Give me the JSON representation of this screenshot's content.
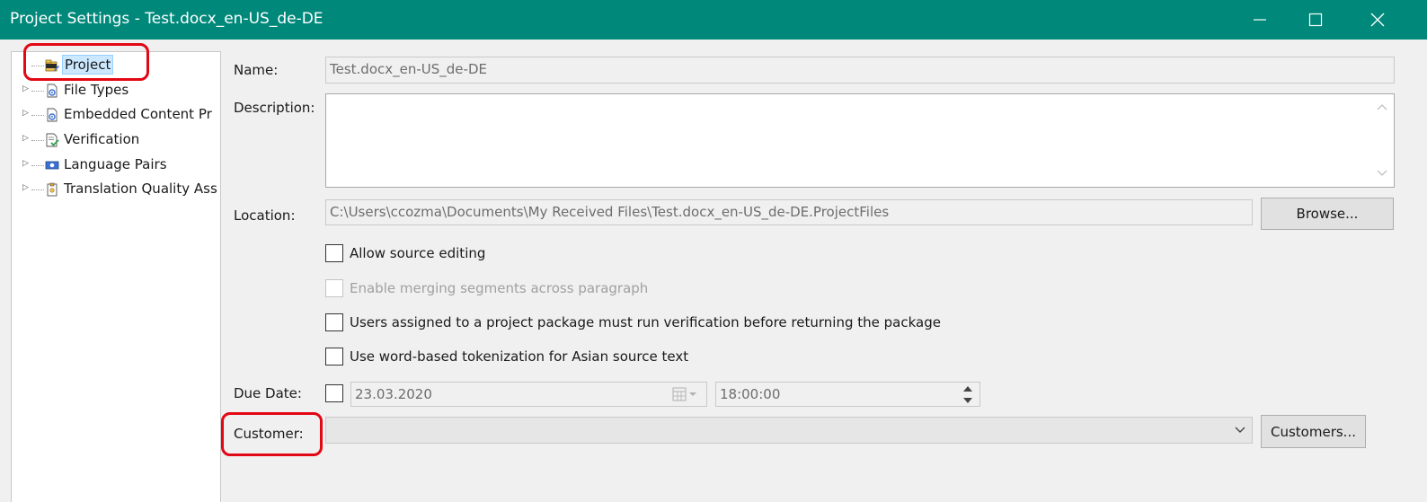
{
  "window": {
    "title": "Project Settings - Test.docx_en-US_de-DE"
  },
  "tree": {
    "items": [
      {
        "label": "Project",
        "icon": "project-icon",
        "selected": true,
        "expandable": false
      },
      {
        "label": "File Types",
        "icon": "file-types-icon",
        "selected": false,
        "expandable": true
      },
      {
        "label": "Embedded Content Pr",
        "icon": "embedded-content-icon",
        "selected": false,
        "expandable": true
      },
      {
        "label": "Verification",
        "icon": "verification-icon",
        "selected": false,
        "expandable": true
      },
      {
        "label": "Language Pairs",
        "icon": "language-pairs-icon",
        "selected": false,
        "expandable": true
      },
      {
        "label": "Translation Quality Ass",
        "icon": "translation-quality-icon",
        "selected": false,
        "expandable": true
      }
    ]
  },
  "form": {
    "name_label": "Name:",
    "name_value": "Test.docx_en-US_de-DE",
    "description_label": "Description:",
    "description_value": "",
    "location_label": "Location:",
    "location_value": "C:\\Users\\ccozma\\Documents\\My Received Files\\Test.docx_en-US_de-DE.ProjectFiles",
    "browse_label": "Browse...",
    "checkboxes": [
      {
        "label": "Allow source editing",
        "checked": false,
        "enabled": true
      },
      {
        "label": "Enable merging segments across paragraph",
        "checked": false,
        "enabled": false
      },
      {
        "label": "Users assigned to a project package must run verification before returning the package",
        "checked": false,
        "enabled": true
      },
      {
        "label": "Use word-based tokenization for Asian source text",
        "checked": false,
        "enabled": true
      }
    ],
    "due_date_label": "Due Date:",
    "due_date_checked": false,
    "due_date_value": "23.03.2020",
    "due_time_value": "18:00:00",
    "customer_label": "Customer:",
    "customer_value": "",
    "customers_button_label": "Customers..."
  },
  "colors": {
    "titlebar": "#00897b",
    "highlight": "#e30613",
    "selection": "#cce8ff"
  }
}
